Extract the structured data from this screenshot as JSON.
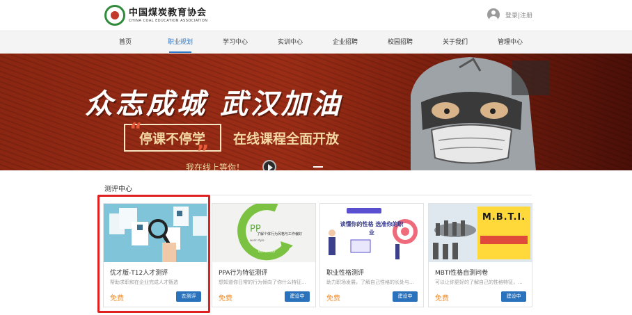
{
  "header": {
    "logo_cn": "中国煤炭教育协会",
    "logo_en": "CHINA COAL EDUCATION ASSOCIATION",
    "login": "登录",
    "separator": "|",
    "register": "注册"
  },
  "nav": {
    "items": [
      {
        "label": "首页"
      },
      {
        "label": "职业规划"
      },
      {
        "label": "学习中心"
      },
      {
        "label": "实训中心"
      },
      {
        "label": "企业招聘"
      },
      {
        "label": "校园招聘"
      },
      {
        "label": "关于我们"
      },
      {
        "label": "管理中心"
      }
    ],
    "active_index": 1
  },
  "banner": {
    "slogan": "众志成城  武汉加油",
    "sub1": "停课不停学",
    "sub2": "在线课程全面开放",
    "bottom": "我在线上等你！"
  },
  "section": {
    "title": "测评中心"
  },
  "cards": [
    {
      "title": "优才版-T12人才测评",
      "desc": "帮助求职和在企业完成人才甄选",
      "price": "免费",
      "button": "去测评",
      "image_text": ""
    },
    {
      "title": "PPA行为特征测评",
      "desc": "想知道你日常的行为倾向了你什么特征...",
      "price": "免费",
      "button": "建设中",
      "image_text": "了解个体行为风格与工作偏好"
    },
    {
      "title": "职业性格测评",
      "desc": "助力职场发展，了解自己性格的长处与...",
      "price": "免费",
      "button": "建设中",
      "image_text": "读懂你的性格 选准你的职业"
    },
    {
      "title": "MBTI性格自测问卷",
      "desc": "可以让你更好的了解自己的性格特征，...",
      "price": "免费",
      "button": "建设中",
      "image_text": "M.B.T.I."
    }
  ],
  "colors": {
    "accent": "#2f78c4",
    "button": "#2a72bb",
    "price": "#f08a24",
    "highlight": "#e02020",
    "banner": "#8a2612"
  }
}
